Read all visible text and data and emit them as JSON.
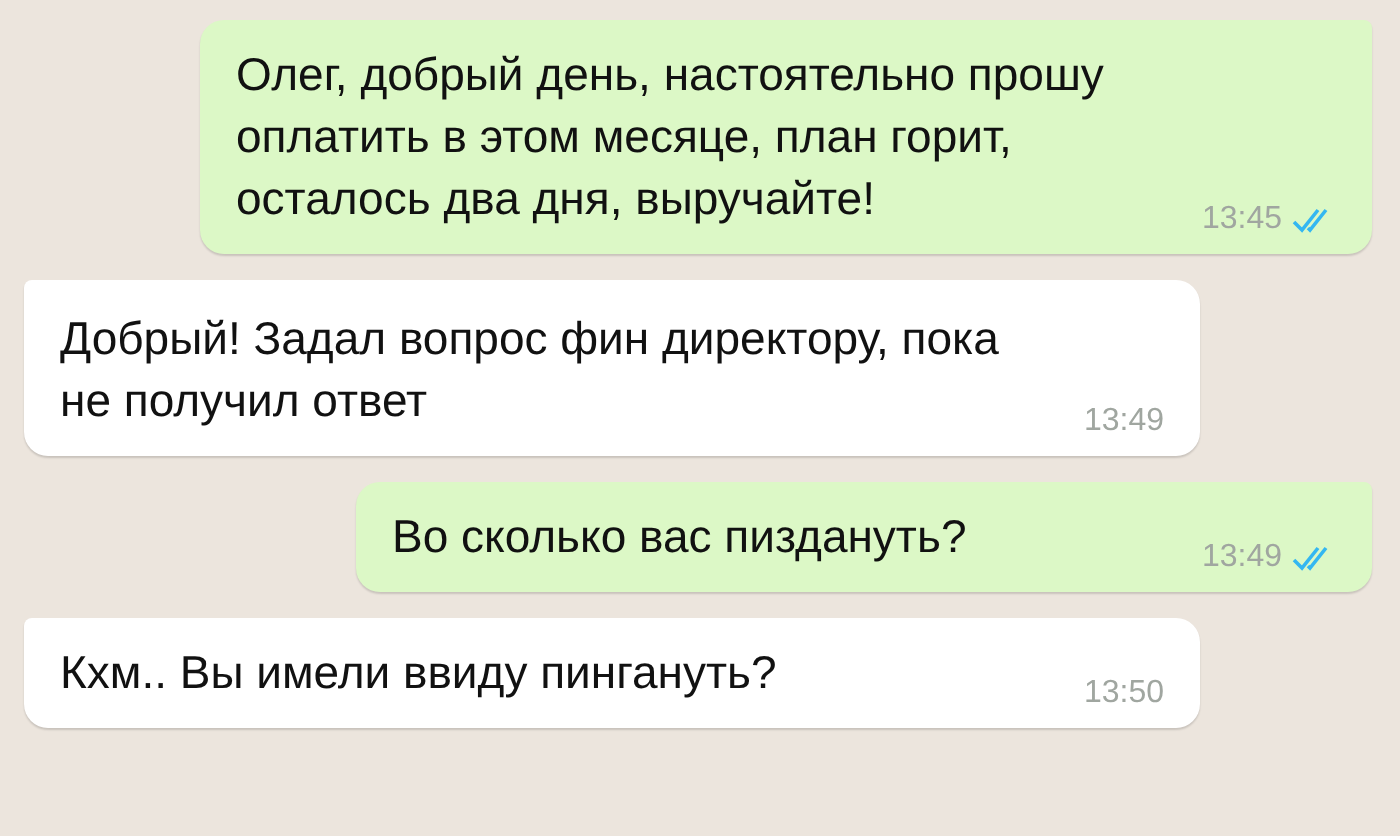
{
  "messages": [
    {
      "kind": "outgoing",
      "text": "Олег, добрый день, настоятельно прошу оплатить в этом месяце, план горит, осталось два дня, выручайте!",
      "time": "13:45",
      "read": true
    },
    {
      "kind": "incoming",
      "text": "Добрый! Задал вопрос фин директору, пока не получил ответ",
      "time": "13:49"
    },
    {
      "kind": "outgoing",
      "text": "Во сколько вас пиздануть?",
      "time": "13:49",
      "read": true
    },
    {
      "kind": "incoming",
      "text": "Кхм.. Вы имели ввиду пингануть?",
      "time": "13:50"
    }
  ]
}
